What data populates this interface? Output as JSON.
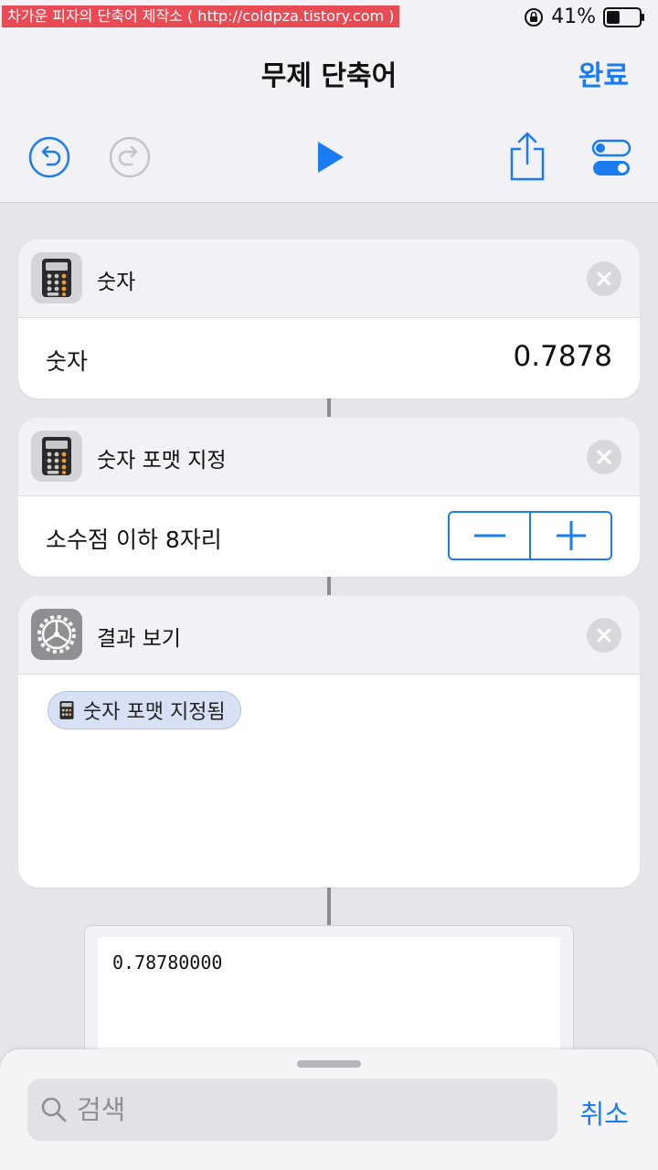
{
  "status_bar": {
    "watermark": "차가운 피자의 단축어 제작소 ( http://coldpza.tistory.com )",
    "battery_percent": "41%",
    "battery_level": 0.41
  },
  "nav": {
    "title": "무제 단축어",
    "done_label": "완료"
  },
  "toolbar": {
    "icons": [
      "undo-icon",
      "redo-icon",
      "play-icon",
      "share-icon",
      "settings-toggle-icon"
    ]
  },
  "actions": [
    {
      "title": "숫자",
      "icon": "calculator-icon",
      "row_label": "숫자",
      "row_value": "0.7878"
    },
    {
      "title": "숫자 포맷 지정",
      "icon": "calculator-icon",
      "row_label": "소수점 이하 8자리"
    },
    {
      "title": "결과 보기",
      "icon": "gear-icon",
      "token_label": "숫자 포맷 지정됨"
    }
  ],
  "output": {
    "text": "0.78780000"
  },
  "search": {
    "placeholder": "검색",
    "value": "",
    "cancel_label": "취소"
  },
  "colors": {
    "accent": "#1a7cf0",
    "watermark_bg": "#e84b54",
    "background": "#e6e6ea"
  }
}
